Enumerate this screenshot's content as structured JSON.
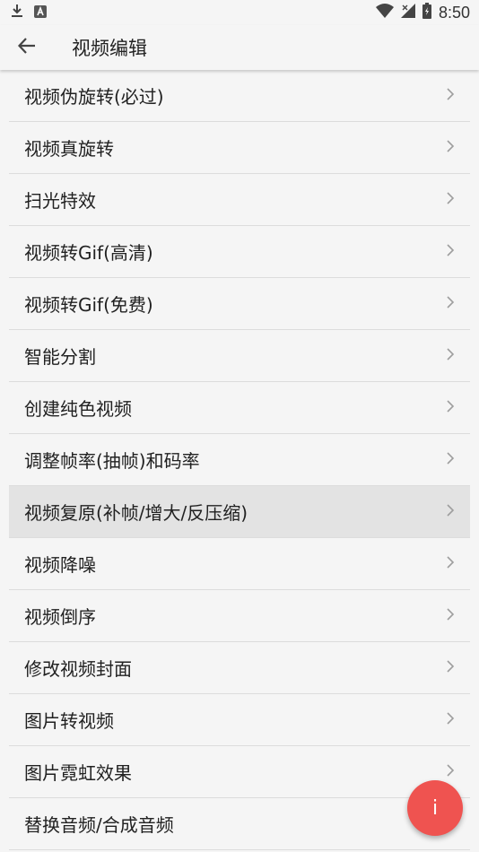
{
  "status_bar": {
    "time": "8:50",
    "icons": [
      "download-icon",
      "notification-a-icon",
      "wifi-icon",
      "signal-icon",
      "battery-icon"
    ]
  },
  "app_bar": {
    "title": "视频编辑",
    "back_icon": "arrow-left-icon"
  },
  "menu": {
    "items": [
      {
        "label": "视频伪旋转(必过)"
      },
      {
        "label": "视频真旋转"
      },
      {
        "label": "扫光特效"
      },
      {
        "label": "视频转Gif(高清)"
      },
      {
        "label": "视频转Gif(免费)"
      },
      {
        "label": "智能分割"
      },
      {
        "label": "创建纯色视频"
      },
      {
        "label": "调整帧率(抽帧)和码率"
      },
      {
        "label": "视频复原(补帧/增大/反压缩)"
      },
      {
        "label": "视频降噪"
      },
      {
        "label": "视频倒序"
      },
      {
        "label": "修改视频封面"
      },
      {
        "label": "图片转视频"
      },
      {
        "label": "图片霓虹效果"
      },
      {
        "label": "替换音频/合成音频"
      }
    ],
    "highlighted_index": 8
  },
  "fab": {
    "label": "i",
    "color": "#ef5350"
  }
}
